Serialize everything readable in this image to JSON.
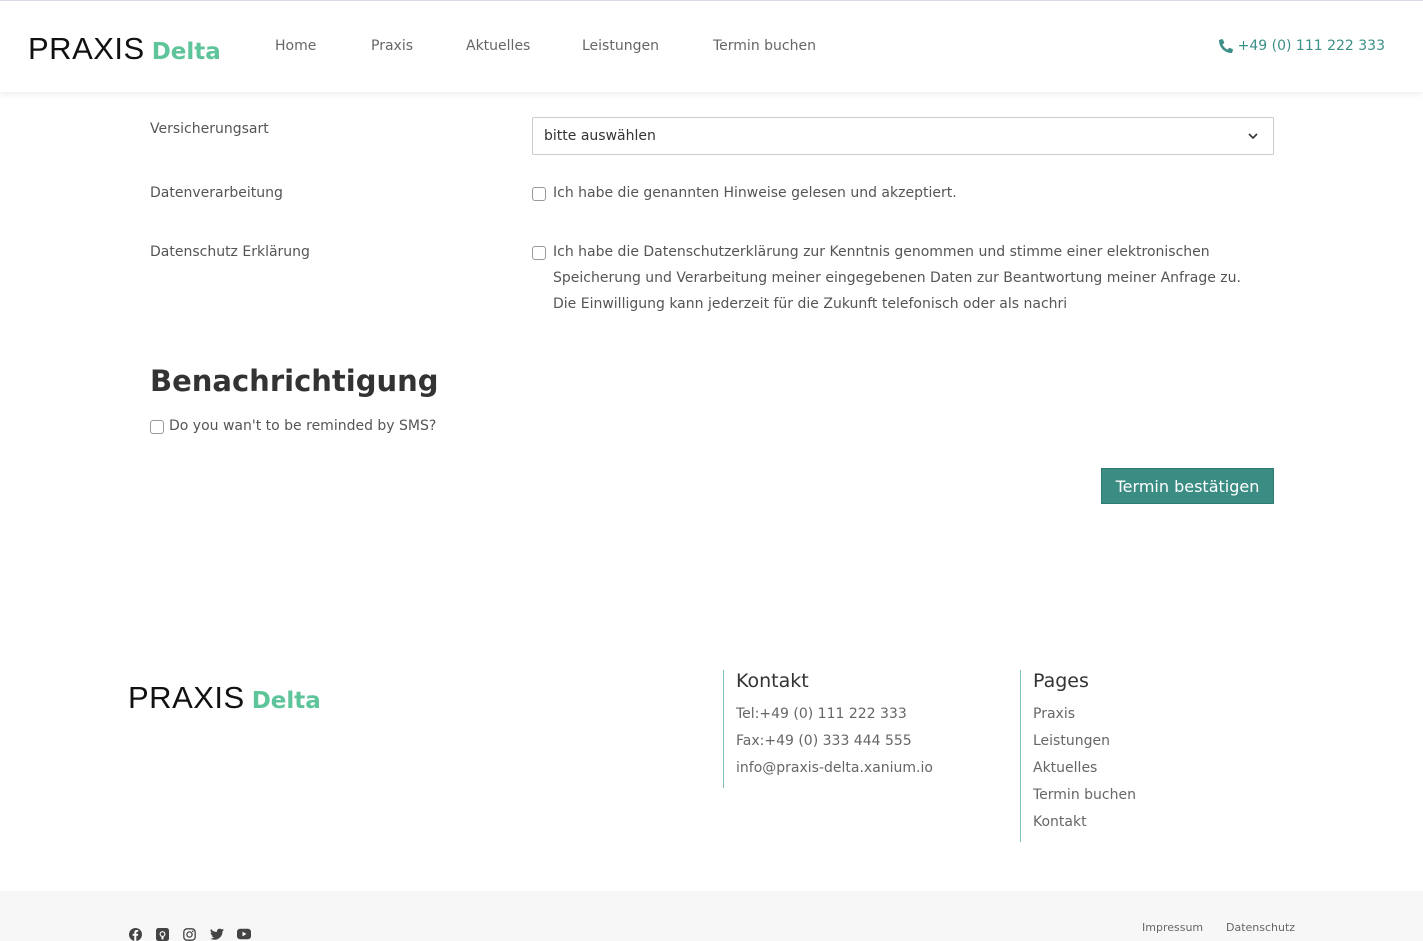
{
  "header": {
    "logo": {
      "word1": "PRAXIS",
      "word2": "Delta"
    },
    "nav": [
      "Home",
      "Praxis",
      "Aktuelles",
      "Leistungen",
      "Termin buchen"
    ],
    "phone": "+49 (0) 111 222 333",
    "phone_icon": "phone-icon"
  },
  "form": {
    "insurance": {
      "label": "Versicherungsart",
      "selected": "bitte auswählen"
    },
    "data_processing": {
      "label": "Datenverarbeitung",
      "checkbox_text": "Ich habe die genannten Hinweise gelesen und akzeptiert.",
      "checked": false
    },
    "privacy": {
      "label": "Datenschutz Erklärung",
      "lines": [
        "Ich habe die Datenschutzerklärung zur Kenntnis genommen und stimme einer elektronischen",
        "Speicherung und Verarbeitung meiner eingegebenen Daten zur Beantwortung meiner Anfrage zu.",
        "Die Einwilligung kann jederzeit für die Zukunft telefonisch oder als nachri"
      ],
      "checked": false
    }
  },
  "notification": {
    "title": "Benachrichtigung",
    "sms_text": "Do you wan't to be reminded by SMS?",
    "checked": false
  },
  "confirm_button": "Termin bestätigen",
  "footer": {
    "logo": {
      "word1": "PRAXIS",
      "word2": "Delta"
    },
    "contact": {
      "title": "Kontakt",
      "lines": [
        "Tel:+49 (0) 111 222 333",
        "Fax:+49 (0) 333 444 555",
        "info@praxis-delta.xanium.io"
      ]
    },
    "pages": {
      "title": "Pages",
      "links": [
        "Praxis",
        "Leistungen",
        "Aktuelles",
        "Termin buchen",
        "Kontakt"
      ]
    },
    "social_icons": [
      "facebook-icon",
      "github-icon",
      "instagram-icon",
      "twitter-icon",
      "youtube-icon"
    ],
    "bottom_links": [
      "Impressum",
      "Datenschutz"
    ]
  },
  "colors": {
    "accent": "#3b8d84",
    "logo_green": "#5ec49a",
    "phone_color": "#3c8f86"
  }
}
